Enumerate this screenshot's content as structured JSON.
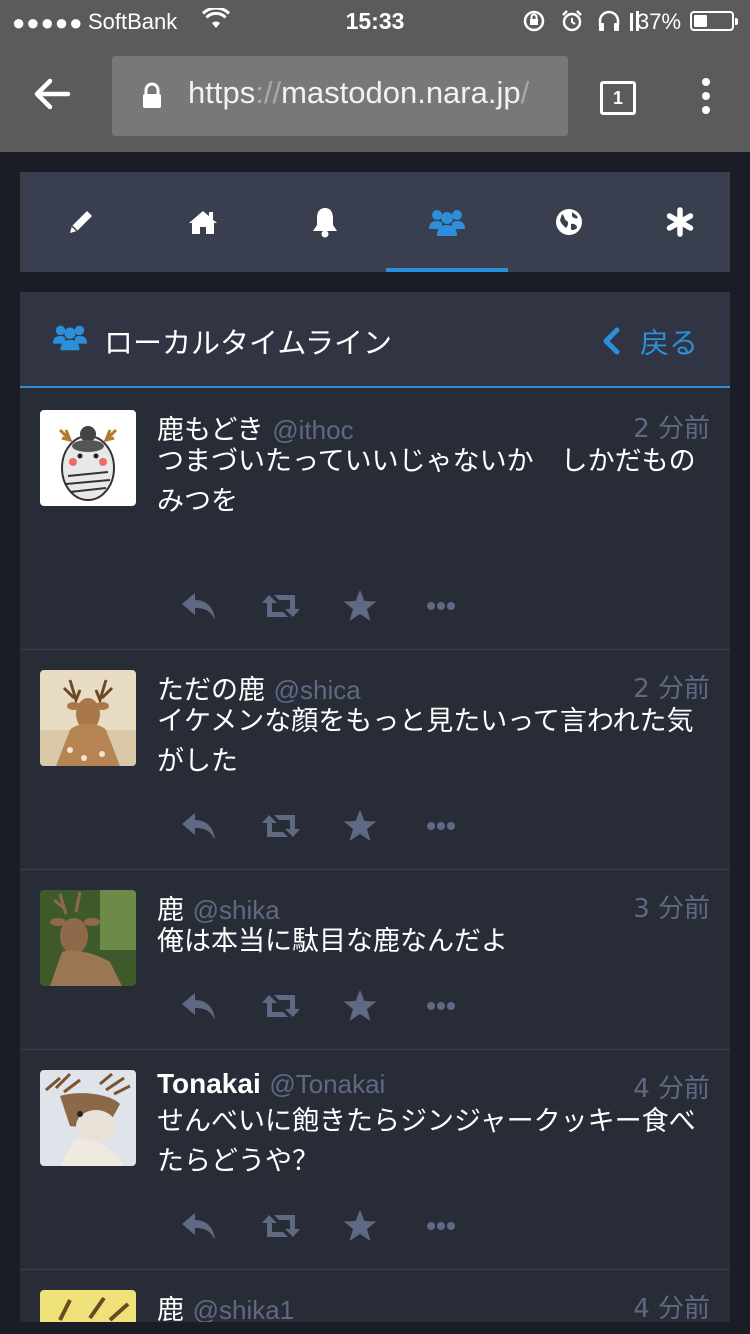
{
  "statusbar": {
    "signal": "●●●●●",
    "carrier": "SoftBank",
    "time": "15:33",
    "battery": "37%",
    "battery_level": 0.37
  },
  "browser": {
    "url_main": "https",
    "url_sep": "://",
    "url_host": "mastodon.nara.jp",
    "url_tail": "/",
    "tab_count": "1"
  },
  "nav": {
    "tabs": [
      {
        "icon": "pencil-icon"
      },
      {
        "icon": "home-icon"
      },
      {
        "icon": "bell-icon"
      },
      {
        "icon": "users-icon",
        "active": true
      },
      {
        "icon": "globe-icon"
      },
      {
        "icon": "asterisk-icon"
      }
    ]
  },
  "column": {
    "title": "ローカルタイムライン",
    "back_label": "戻る"
  },
  "statuses": [
    {
      "name": "鹿もどき",
      "acct": "@ithoc",
      "time": "2 分前",
      "content": "つまづいたっていいじゃないか　しかだもの\nみつを"
    },
    {
      "name": "ただの鹿",
      "acct": "@shica",
      "time": "2 分前",
      "content": "イケメンな顔をもっと見たいって言われた気がした"
    },
    {
      "name": "鹿",
      "acct": "@shika",
      "time": "3 分前",
      "content": "俺は本当に駄目な鹿なんだよ"
    },
    {
      "name": "Tonakai",
      "acct": "@Tonakai",
      "time": "4 分前",
      "content": "せんべいに飽きたらジンジャークッキー食べたらどうや？"
    },
    {
      "name": "鹿",
      "acct": "@shika1",
      "time": "4 分前",
      "content": ""
    }
  ],
  "colors": {
    "accent": "#2b90d9",
    "background": "#282c37",
    "muted": "#606984"
  }
}
